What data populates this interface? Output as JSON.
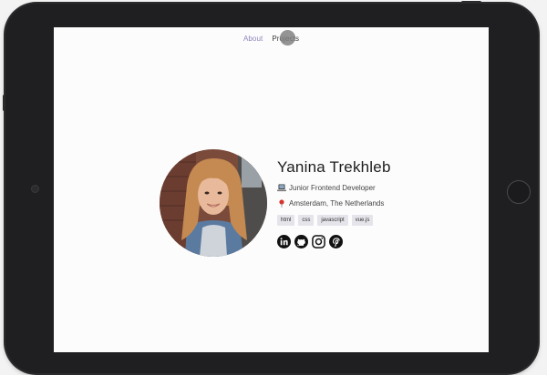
{
  "nav": {
    "items": [
      {
        "label": "About"
      },
      {
        "label": "Projects"
      }
    ]
  },
  "profile": {
    "name": "Yanina Trekhleb",
    "role": "Junior Frontend Developer",
    "location": "Amsterdam, The Netherlands",
    "role_icon": "laptop-icon",
    "location_icon": "pin-icon",
    "tags": [
      "html",
      "css",
      "javascript",
      "vue.js"
    ],
    "socials": [
      "linkedin-icon",
      "github-icon",
      "instagram-icon",
      "pinterest-icon"
    ]
  },
  "colors": {
    "nav_active": "#8b86b8",
    "device_frame": "#1f1f21",
    "screen_bg": "#fdfcfd",
    "tag_bg": "#e4e4ea"
  }
}
